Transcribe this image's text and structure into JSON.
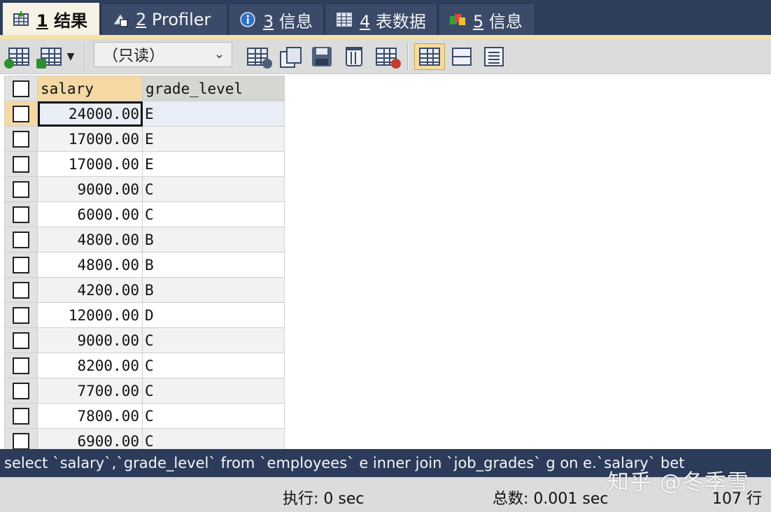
{
  "tabs": [
    {
      "number": "1",
      "label": "结果",
      "icon": "result-grid-icon",
      "active": true
    },
    {
      "number": "2",
      "label": "Profiler",
      "icon": "profiler-icon"
    },
    {
      "number": "3",
      "label": "信息",
      "icon": "info-icon"
    },
    {
      "number": "4",
      "label": "表数据",
      "icon": "table-data-icon"
    },
    {
      "number": "5",
      "label": "信息",
      "icon": "info-history-icon"
    }
  ],
  "toolbar": {
    "mode_select": {
      "value": "（只读）"
    },
    "buttons": [
      "insert-row-icon",
      "export-icon",
      "duplicate-row-icon",
      "copy-row-icon",
      "save-icon",
      "delete-icon",
      "cancel-changes-icon",
      "grid-view-icon",
      "form-view-icon",
      "text-view-icon"
    ]
  },
  "grid": {
    "columns": [
      "salary",
      "grade_level"
    ],
    "rows": [
      {
        "salary": "24000.00",
        "grade_level": "E"
      },
      {
        "salary": "17000.00",
        "grade_level": "E"
      },
      {
        "salary": "17000.00",
        "grade_level": "E"
      },
      {
        "salary": "9000.00",
        "grade_level": "C"
      },
      {
        "salary": "6000.00",
        "grade_level": "C"
      },
      {
        "salary": "4800.00",
        "grade_level": "B"
      },
      {
        "salary": "4800.00",
        "grade_level": "B"
      },
      {
        "salary": "4200.00",
        "grade_level": "B"
      },
      {
        "salary": "12000.00",
        "grade_level": "D"
      },
      {
        "salary": "9000.00",
        "grade_level": "C"
      },
      {
        "salary": "8200.00",
        "grade_level": "C"
      },
      {
        "salary": "7700.00",
        "grade_level": "C"
      },
      {
        "salary": "7800.00",
        "grade_level": "C"
      },
      {
        "salary": "6900.00",
        "grade_level": "C"
      }
    ]
  },
  "sql": "select `salary`,`grade_level` from `employees` e inner join `job_grades` g on e.`salary` bet",
  "status": {
    "exec": "执行: 0 sec",
    "total": "总数: 0.001 sec",
    "rows": "107 行"
  },
  "watermark": "知乎 @冬季雪",
  "colors": {
    "tab_bar": "#2e3d5a",
    "active_tab": "#f6f2e4",
    "sql_bar": "#2c3b59",
    "sorted_header": "#f4d9a4"
  }
}
